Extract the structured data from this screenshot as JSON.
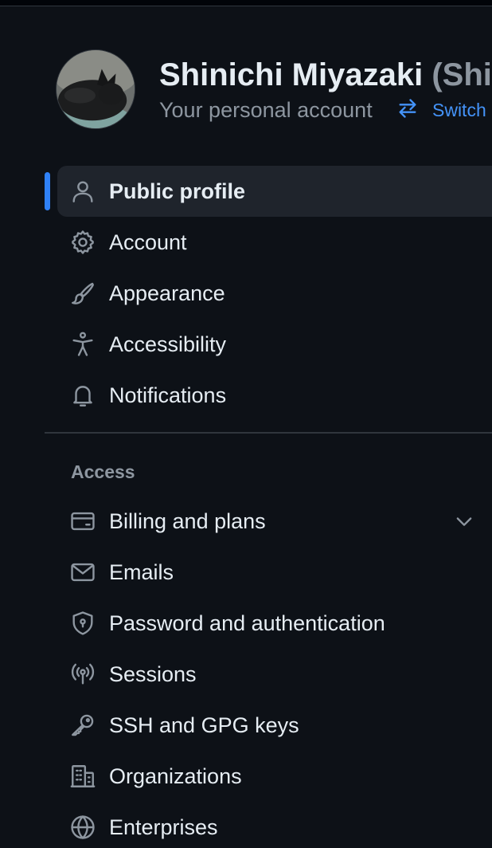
{
  "header": {
    "display_name": "Shinichi Miyazaki",
    "handle_fragment": "(Shin",
    "account_type": "Your personal account",
    "switch_label": "Switch"
  },
  "nav": {
    "items": [
      {
        "label": "Public profile",
        "icon": "person-icon",
        "active": true
      },
      {
        "label": "Account",
        "icon": "gear-icon"
      },
      {
        "label": "Appearance",
        "icon": "paintbrush-icon"
      },
      {
        "label": "Accessibility",
        "icon": "accessibility-icon"
      },
      {
        "label": "Notifications",
        "icon": "bell-icon"
      }
    ]
  },
  "access": {
    "heading": "Access",
    "items": [
      {
        "label": "Billing and plans",
        "icon": "credit-card-icon",
        "expandable": true
      },
      {
        "label": "Emails",
        "icon": "mail-icon"
      },
      {
        "label": "Password and authentication",
        "icon": "shield-lock-icon"
      },
      {
        "label": "Sessions",
        "icon": "broadcast-icon"
      },
      {
        "label": "SSH and GPG keys",
        "icon": "key-icon"
      },
      {
        "label": "Organizations",
        "icon": "organization-icon"
      },
      {
        "label": "Enterprises",
        "icon": "globe-icon"
      }
    ]
  },
  "colors": {
    "background": "#0d1117",
    "active_item_bg": "#1f242c",
    "accent": "#2f81f7",
    "link": "#4493f8",
    "muted_text": "#8d96a0"
  }
}
